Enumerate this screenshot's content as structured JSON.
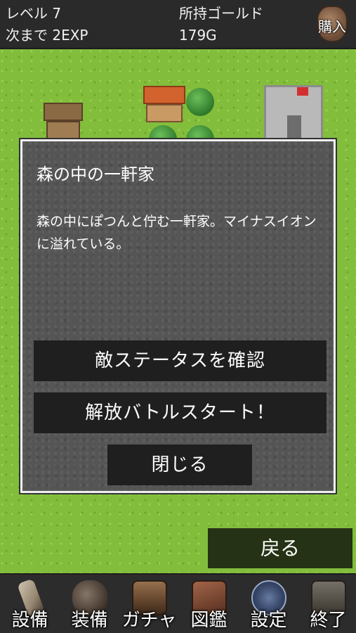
{
  "status": {
    "level_label": "レベル 7",
    "next_label": "次まで 2EXP",
    "gold_label": "所持ゴールド",
    "gold_value": "179G",
    "buy_label": "購入"
  },
  "dialog": {
    "title": "森の中の一軒家",
    "description": "森の中にぽつんと佇む一軒家。マイナスイオンに溢れている。",
    "buttons": {
      "status": "敵ステータスを確認",
      "battle": "解放バトルスタート！",
      "close": "閉じる"
    }
  },
  "back_label": "戻る",
  "nav": [
    {
      "label": "設備",
      "icon": "quill-icon"
    },
    {
      "label": "装備",
      "icon": "bag-icon"
    },
    {
      "label": "ガチャ",
      "icon": "treasure-chest-icon"
    },
    {
      "label": "図鑑",
      "icon": "book-icon"
    },
    {
      "label": "設定",
      "icon": "magic-circle-icon"
    },
    {
      "label": "終了",
      "icon": "exit-door-icon"
    }
  ],
  "colors": {
    "grass": "#82bd3c",
    "panel": "#555555",
    "button": "#1f1f1f",
    "back_button": "#263215"
  }
}
